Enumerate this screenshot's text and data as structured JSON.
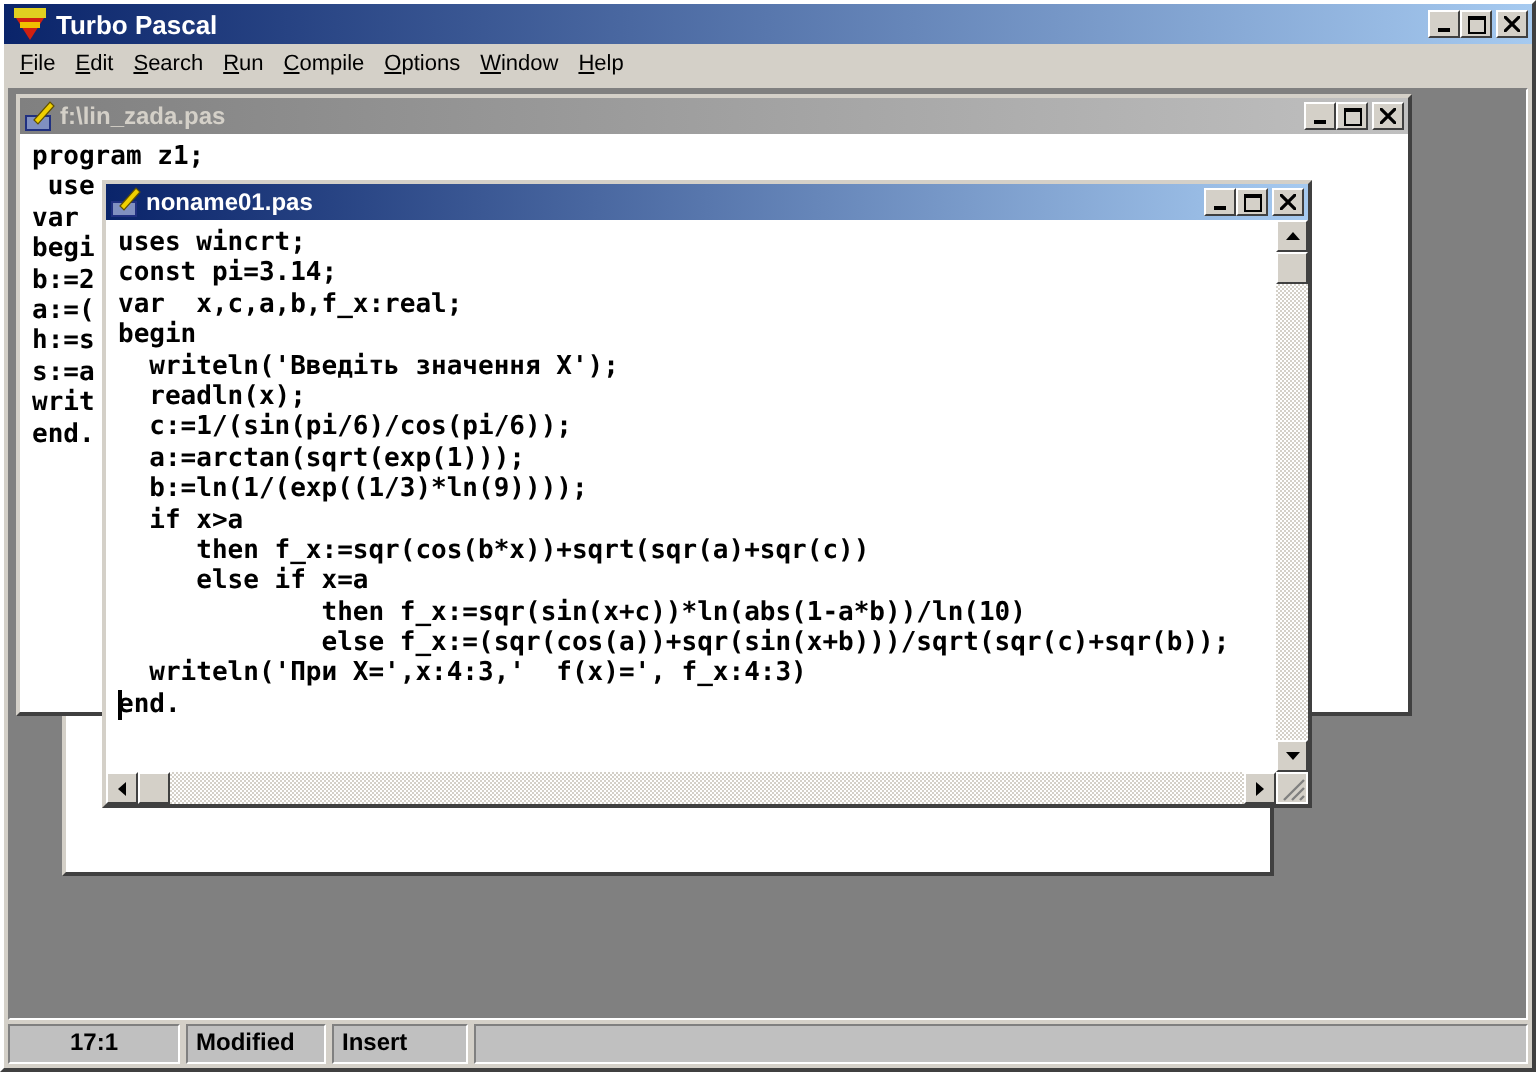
{
  "app": {
    "title": "Turbo Pascal"
  },
  "menu": [
    {
      "label": "File"
    },
    {
      "label": "Edit"
    },
    {
      "label": "Search"
    },
    {
      "label": "Run"
    },
    {
      "label": "Compile"
    },
    {
      "label": "Options"
    },
    {
      "label": "Window"
    },
    {
      "label": "Help"
    }
  ],
  "windows": [
    {
      "kind": "blank"
    },
    {
      "kind": "editor",
      "title": "f:\\lin_zada.pas",
      "active": false,
      "lines": [
        "program z1;",
        " use",
        "var",
        "begi",
        "b:=2",
        "a:=(",
        "h:=s",
        "s:=a",
        "writ",
        "end."
      ]
    },
    {
      "kind": "editor",
      "title": "noname01.pas",
      "active": true,
      "scrollbars": true,
      "lines": [
        "uses wincrt;",
        "const pi=3.14;",
        "var  x,c,a,b,f_x:real;",
        "begin",
        "  writeln('Введіть значення X');",
        "  readln(x);",
        "  c:=1/(sin(pi/6)/cos(pi/6));",
        "  a:=arctan(sqrt(exp(1)));",
        "  b:=ln(1/(exp((1/3)*ln(9))));",
        "  if x>a",
        "     then f_x:=sqr(cos(b*x))+sqrt(sqr(a)+sqr(c))",
        "     else if x=a",
        "             then f_x:=sqr(sin(x+c))*ln(abs(1-a*b))/ln(10)",
        "             else f_x:=(sqr(cos(a))+sqr(sin(x+b)))/sqrt(sqr(c)+sqr(b));",
        "  writeln('При X=',x:4:3,'  f(x)=', f_x:4:3)",
        "end."
      ]
    }
  ],
  "status_bar": [
    "17:1",
    "Modified",
    "Insert"
  ]
}
